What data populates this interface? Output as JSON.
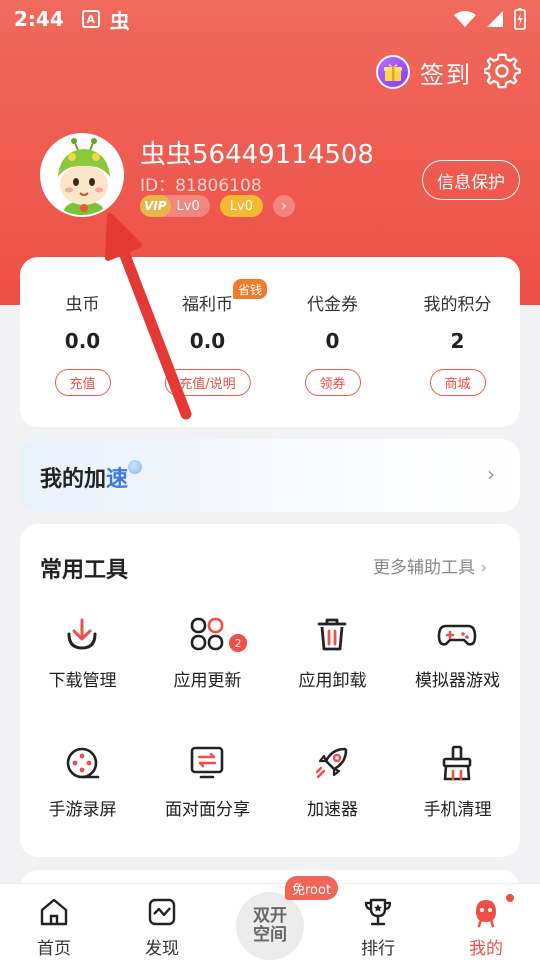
{
  "status_bar": {
    "time": "2:44",
    "app_icon_a": "A",
    "app_icon_bug": "虫"
  },
  "header": {
    "signin_label": "签到",
    "icons": {
      "signin": "gift-icon",
      "settings": "gear-icon"
    }
  },
  "profile": {
    "username": "虫虫56449114508",
    "id_text": "ID：81806108",
    "vip_tag": "VIP",
    "vip_level": "Lv0",
    "user_level": "Lv0",
    "privacy_button": "信息保护"
  },
  "stats": [
    {
      "label": "虫币",
      "value": "0.0",
      "button": "充值"
    },
    {
      "label": "福利币",
      "value": "0.0",
      "button": "充值/说明",
      "badge": "省钱"
    },
    {
      "label": "代金券",
      "value": "0",
      "button": "领券"
    },
    {
      "label": "我的积分",
      "value": "2",
      "button": "商城"
    }
  ],
  "accelerate": {
    "title_prefix": "我的加",
    "title_highlight": "速"
  },
  "tools": {
    "title": "常用工具",
    "more": "更多辅助工具",
    "items": [
      {
        "label": "下载管理",
        "icon": "download-icon"
      },
      {
        "label": "应用更新",
        "icon": "app-update-icon",
        "badge": "2"
      },
      {
        "label": "应用卸载",
        "icon": "trash-icon"
      },
      {
        "label": "模拟器游戏",
        "icon": "gamepad-icon"
      },
      {
        "label": "手游录屏",
        "icon": "film-reel-icon"
      },
      {
        "label": "面对面分享",
        "icon": "share-screen-icon"
      },
      {
        "label": "加速器",
        "icon": "rocket-icon"
      },
      {
        "label": "手机清理",
        "icon": "brush-icon"
      }
    ]
  },
  "bottom_nav": {
    "items": [
      {
        "label": "首页",
        "icon": "home-icon"
      },
      {
        "label": "发现",
        "icon": "discover-icon"
      },
      {
        "label": "排行",
        "icon": "trophy-icon"
      },
      {
        "label": "我的",
        "icon": "profile-icon",
        "active": true
      }
    ],
    "center_line1": "双开",
    "center_line2": "空间",
    "center_badge": "免root"
  },
  "colors": {
    "primary": "#ee4f46",
    "header_top": "#f06a5c",
    "accent_blue": "#3b7be0",
    "badge_orange": "#f27a2b"
  }
}
